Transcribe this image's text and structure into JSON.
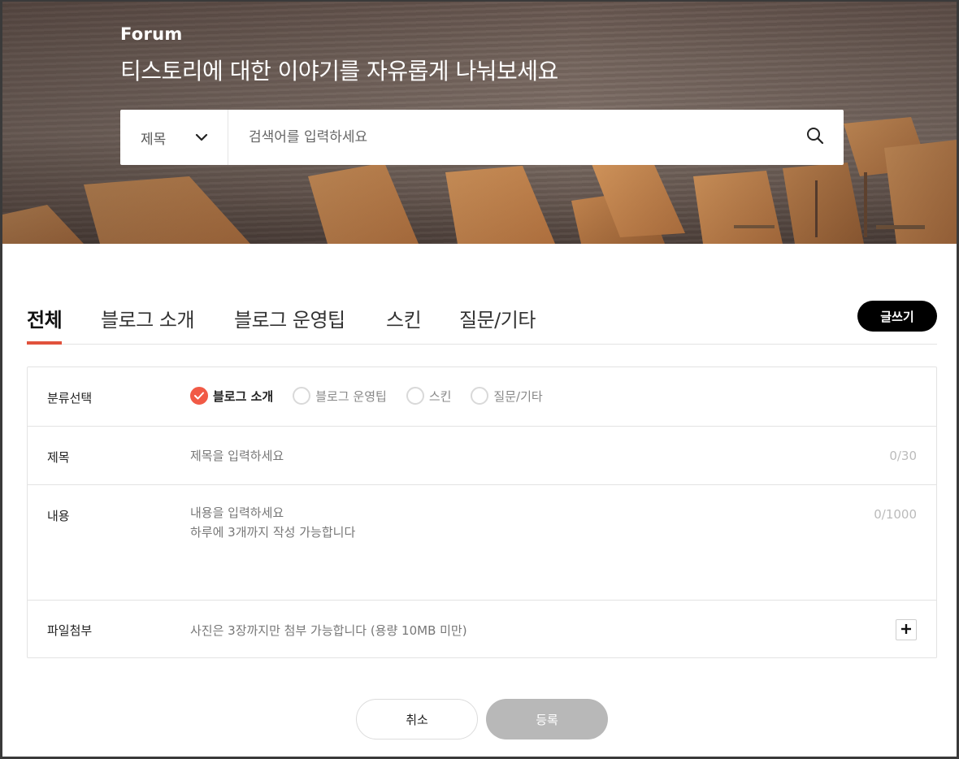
{
  "hero": {
    "brand": "Forum",
    "headline": "티스토리에 대한 이야기를 자유롭게 나눠보세요"
  },
  "search": {
    "scope_label": "제목",
    "scope_icon": "chevron-down-icon",
    "placeholder": "검색어를 입력하세요",
    "button_icon": "search-icon"
  },
  "tabs": [
    {
      "label": "전체",
      "active": true
    },
    {
      "label": "블로그 소개",
      "active": false
    },
    {
      "label": "블로그 운영팁",
      "active": false
    },
    {
      "label": "스킨",
      "active": false
    },
    {
      "label": "질문/기타",
      "active": false
    }
  ],
  "write_button": "글쓰기",
  "form": {
    "category": {
      "label": "분류선택",
      "options": [
        {
          "label": "블로그 소개",
          "checked": true
        },
        {
          "label": "블로그 운영팁",
          "checked": false
        },
        {
          "label": "스킨",
          "checked": false
        },
        {
          "label": "질문/기타",
          "checked": false
        }
      ]
    },
    "title": {
      "label": "제목",
      "placeholder": "제목을 입력하세요",
      "counter": "0/30"
    },
    "content": {
      "label": "내용",
      "placeholder": "내용을 입력하세요\n하루에 3개까지 작성 가능합니다",
      "counter": "0/1000"
    },
    "attachment": {
      "label": "파일첨부",
      "hint": "사진은 3장까지만 첨부 가능합니다 (용량 10MB 미만)",
      "add_icon": "plus-icon"
    }
  },
  "actions": {
    "cancel": "취소",
    "submit": "등록"
  },
  "colors": {
    "accent": "#f15a46",
    "tab_underline": "#e1523d",
    "write_button_bg": "#000000",
    "submit_disabled_bg": "#b8b8b8"
  }
}
